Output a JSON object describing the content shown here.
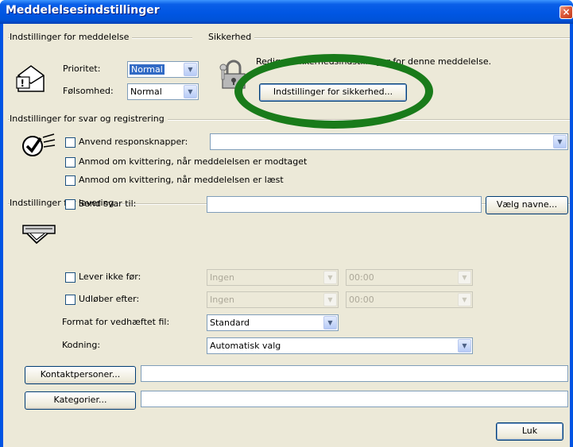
{
  "window": {
    "title": "Meddelelsesindstillinger",
    "close_glyph": "×"
  },
  "message_settings": {
    "heading": "Indstillinger for meddelelse",
    "priority_label": "Prioritet:",
    "priority_value": "Normal",
    "sensitivity_label": "Følsomhed:",
    "sensitivity_value": "Normal"
  },
  "security": {
    "heading": "Sikkerhed",
    "description": "Rediger sikkerhedsindstillinger for denne meddelelse.",
    "button_label": "Indstillinger for sikkerhed..."
  },
  "voting": {
    "heading": "Indstillinger for svar og registrering",
    "use_voting_label": "Anvend responsknapper:",
    "delivery_receipt_label": "Anmod om kvittering, når meddelelsen er modtaget",
    "read_receipt_label": "Anmod om kvittering, når meddelelsen er læst"
  },
  "delivery": {
    "heading": "Indstillinger for levering",
    "replies_label": "Send svar til:",
    "select_names_label": "Vælg navne...",
    "do_not_deliver_label": "Lever ikke før:",
    "do_not_deliver_date": "Ingen",
    "do_not_deliver_time": "00:00",
    "expires_label": "Udløber efter:",
    "expires_date": "Ingen",
    "expires_time": "00:00",
    "attachment_format_label": "Format for vedhæftet fil:",
    "attachment_format_value": "Standard",
    "encoding_label": "Kodning:",
    "encoding_value": "Automatisk valg"
  },
  "footer": {
    "contacts_label": "Kontaktpersoner...",
    "categories_label": "Kategorier...",
    "close_label": "Luk"
  },
  "colors": {
    "title_bar": "#0054e3",
    "dialog_face": "#ece9d8",
    "annotation_ring": "#197b1a",
    "selection": "#316ac5"
  },
  "icons": [
    "envelope-importance-icon",
    "padlock-keys-icon",
    "voting-checkmark-icon",
    "delivery-hand-icon"
  ]
}
